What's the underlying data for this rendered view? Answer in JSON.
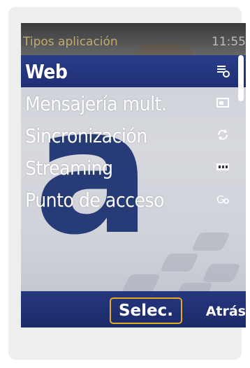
{
  "status": {
    "title": "Tipos aplicación",
    "time": "11:55"
  },
  "menu": {
    "items": [
      {
        "label": "Web",
        "icon": "web-settings-icon",
        "selected": true
      },
      {
        "label": "Mensajería mult.",
        "icon": "multimedia-message-icon",
        "selected": false
      },
      {
        "label": "Sincronización",
        "icon": "sync-icon",
        "selected": false
      },
      {
        "label": "Streaming",
        "icon": "streaming-icon",
        "selected": false
      },
      {
        "label": "Punto de acceso",
        "icon": "access-point-icon",
        "selected": false
      }
    ]
  },
  "softkeys": {
    "center": "Selec.",
    "right": "Atrás"
  },
  "colors": {
    "highlight": "#1e2f74",
    "softkey_outline": "#e7a91e",
    "wallpaper_letter": "#1e3471"
  }
}
